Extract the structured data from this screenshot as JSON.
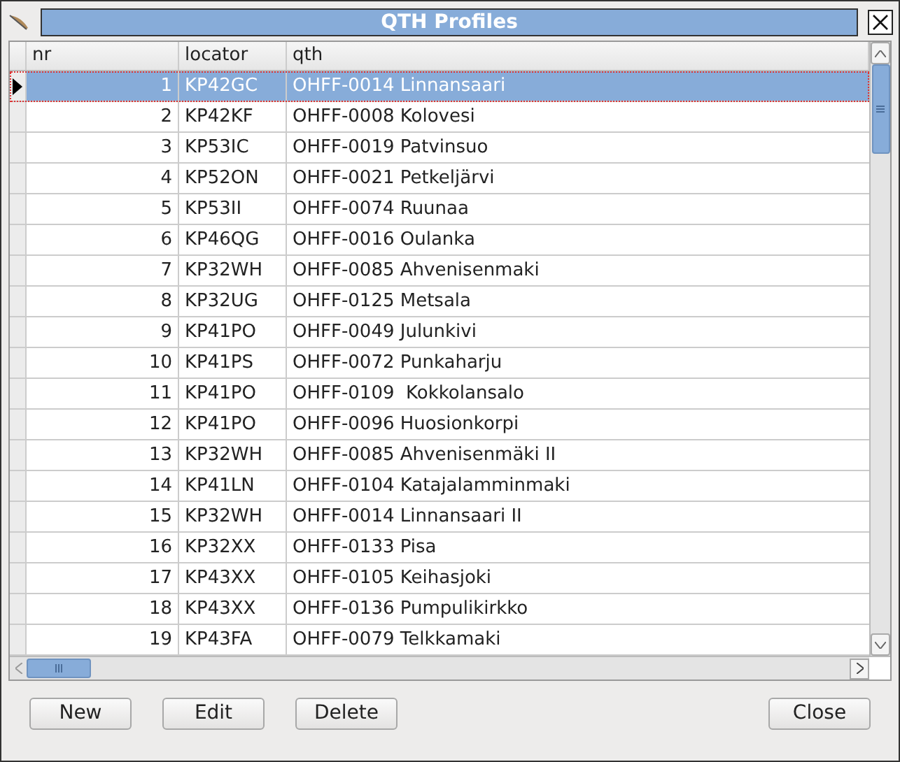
{
  "window": {
    "title": "QTH Profiles"
  },
  "table": {
    "columns": [
      "nr",
      "locator",
      "qth"
    ],
    "rows": [
      {
        "nr": "1",
        "locator": "KP42GC",
        "qth": "OHFF-0014 Linnansaari",
        "selected": true
      },
      {
        "nr": "2",
        "locator": "KP42KF",
        "qth": "OHFF-0008 Kolovesi",
        "selected": false
      },
      {
        "nr": "3",
        "locator": "KP53IC",
        "qth": "OHFF-0019 Patvinsuo",
        "selected": false
      },
      {
        "nr": "4",
        "locator": "KP52ON",
        "qth": "OHFF-0021 Petkeljärvi",
        "selected": false
      },
      {
        "nr": "5",
        "locator": "KP53II",
        "qth": "OHFF-0074 Ruunaa",
        "selected": false
      },
      {
        "nr": "6",
        "locator": "KP46QG",
        "qth": "OHFF-0016 Oulanka",
        "selected": false
      },
      {
        "nr": "7",
        "locator": "KP32WH",
        "qth": "OHFF-0085 Ahvenisenmaki",
        "selected": false
      },
      {
        "nr": "8",
        "locator": "KP32UG",
        "qth": "OHFF-0125 Metsala",
        "selected": false
      },
      {
        "nr": "9",
        "locator": "KP41PO",
        "qth": "OHFF-0049 Julunkivi",
        "selected": false
      },
      {
        "nr": "10",
        "locator": "KP41PS",
        "qth": "OHFF-0072 Punkaharju",
        "selected": false
      },
      {
        "nr": "11",
        "locator": "KP41PO",
        "qth": "OHFF-0109  Kokkolansalo",
        "selected": false
      },
      {
        "nr": "12",
        "locator": "KP41PO",
        "qth": "OHFF-0096 Huosionkorpi",
        "selected": false
      },
      {
        "nr": "13",
        "locator": "KP32WH",
        "qth": "OHFF-0085 Ahvenisenmäki II",
        "selected": false
      },
      {
        "nr": "14",
        "locator": "KP41LN",
        "qth": "OHFF-0104 Katajalamminmaki",
        "selected": false
      },
      {
        "nr": "15",
        "locator": "KP32WH",
        "qth": "OHFF-0014 Linnansaari II",
        "selected": false
      },
      {
        "nr": "16",
        "locator": "KP32XX",
        "qth": "OHFF-0133 Pisa",
        "selected": false
      },
      {
        "nr": "17",
        "locator": "KP43XX",
        "qth": "OHFF-0105 Keihasjoki",
        "selected": false
      },
      {
        "nr": "18",
        "locator": "KP43XX",
        "qth": "OHFF-0136 Pumpulikirkko",
        "selected": false
      },
      {
        "nr": "19",
        "locator": "KP43FA",
        "qth": "OHFF-0079 Telkkamaki",
        "selected": false
      }
    ]
  },
  "buttons": {
    "left": [
      "New",
      "Edit",
      "Delete"
    ],
    "right": [
      "Close"
    ]
  }
}
